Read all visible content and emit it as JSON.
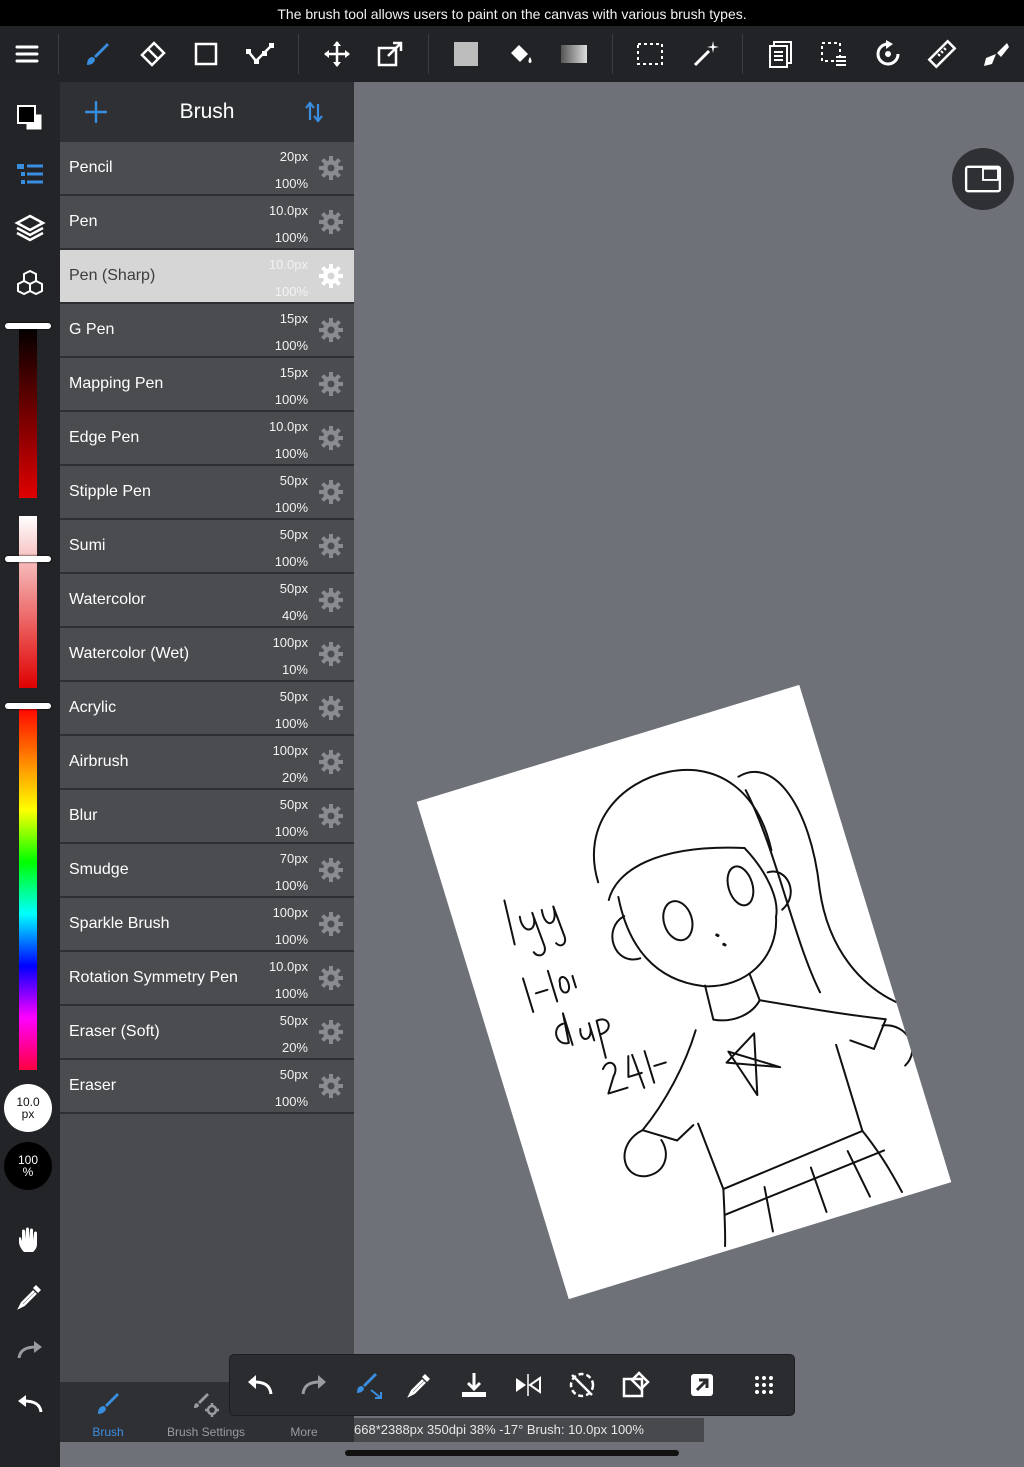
{
  "hint": "The brush tool allows users to paint on the canvas with various brush types.",
  "panel": {
    "title": "Brush",
    "brushes": [
      {
        "name": "Pencil",
        "size": "20px",
        "opacity": "100%"
      },
      {
        "name": "Pen",
        "size": "10.0px",
        "opacity": "100%"
      },
      {
        "name": "Pen (Sharp)",
        "size": "10.0px",
        "opacity": "100%",
        "selected": true
      },
      {
        "name": "G Pen",
        "size": "15px",
        "opacity": "100%"
      },
      {
        "name": "Mapping Pen",
        "size": "15px",
        "opacity": "100%"
      },
      {
        "name": "Edge Pen",
        "size": "10.0px",
        "opacity": "100%"
      },
      {
        "name": "Stipple Pen",
        "size": "50px",
        "opacity": "100%"
      },
      {
        "name": "Sumi",
        "size": "50px",
        "opacity": "100%"
      },
      {
        "name": "Watercolor",
        "size": "50px",
        "opacity": "40%"
      },
      {
        "name": "Watercolor (Wet)",
        "size": "100px",
        "opacity": "10%"
      },
      {
        "name": "Acrylic",
        "size": "50px",
        "opacity": "100%"
      },
      {
        "name": "Airbrush",
        "size": "100px",
        "opacity": "20%"
      },
      {
        "name": "Blur",
        "size": "50px",
        "opacity": "100%"
      },
      {
        "name": "Smudge",
        "size": "70px",
        "opacity": "100%"
      },
      {
        "name": "Sparkle Brush",
        "size": "100px",
        "opacity": "100%"
      },
      {
        "name": "Rotation Symmetry Pen",
        "size": "10.0px",
        "opacity": "100%"
      },
      {
        "name": "Eraser (Soft)",
        "size": "50px",
        "opacity": "20%"
      },
      {
        "name": "Eraser",
        "size": "50px",
        "opacity": "100%"
      }
    ],
    "tabs": [
      "Brush",
      "Brush Settings",
      "More"
    ]
  },
  "readouts": {
    "size_value": "10.0",
    "size_unit": "px",
    "opacity_value": "100",
    "opacity_unit": "%"
  },
  "sliders": {
    "dark_red": 1.0,
    "light_red": 0.75,
    "hue": 1.0
  },
  "status": "668*2388px 350dpi 38% -17° Brush: 10.0px 100%",
  "colors": {
    "accent": "#3a8ee0",
    "toolbar": "#222326",
    "canvas_bg": "#6e7178",
    "panel": "#4a4b4f",
    "selected_row": "#d6d6d6"
  },
  "canvas": {
    "rotation_deg": -17
  }
}
